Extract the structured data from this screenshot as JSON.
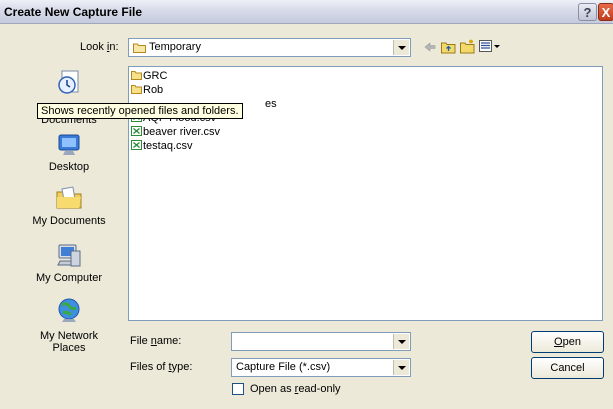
{
  "title": "Create New Capture File",
  "titlebar": {
    "help": "?",
    "close": "X"
  },
  "lookin": {
    "label_pre": "Look ",
    "label_u": "i",
    "label_post": "n:",
    "value": "Temporary"
  },
  "places": [
    {
      "label": "My Recent Documents",
      "icon": "recent-documents-icon"
    },
    {
      "label": "Desktop",
      "icon": "desktop-icon"
    },
    {
      "label": "My Documents",
      "icon": "my-documents-icon"
    },
    {
      "label": "My Computer",
      "icon": "my-computer-icon"
    },
    {
      "label": "My Network Places",
      "icon": "network-places-icon"
    }
  ],
  "places_partial": {
    "recent_line1": "My",
    "recent_line2": "Documents",
    "network_line1": "My Network",
    "network_line2": "Places"
  },
  "files": [
    {
      "name": "GRC",
      "type": "folder"
    },
    {
      "name": "Rob",
      "type": "folder"
    },
    {
      "name": "es",
      "type": "folder"
    },
    {
      "name": "AQP Flood.csv",
      "type": "csv"
    },
    {
      "name": "beaver river.csv",
      "type": "csv"
    },
    {
      "name": "testaq.csv",
      "type": "csv"
    }
  ],
  "tooltip": "Shows recently opened files and folders.",
  "filename": {
    "label_pre": "File ",
    "label_u": "n",
    "label_post": "ame:",
    "value": ""
  },
  "filetype": {
    "label_pre": "Files of ",
    "label_u": "t",
    "label_post": "ype:",
    "value": "Capture File (*.csv)"
  },
  "buttons": {
    "open_u": "O",
    "open_rest": "pen",
    "cancel": "Cancel"
  },
  "readonly": {
    "pre": "Open as ",
    "u": "r",
    "post": "ead-only"
  },
  "colors": {
    "folder": "#e8c65a",
    "csv": "#2e8b3a",
    "list_border": "#7f9db9",
    "dialog_bg": "#ece9d8",
    "tooltip_bg": "#ffffe1"
  }
}
